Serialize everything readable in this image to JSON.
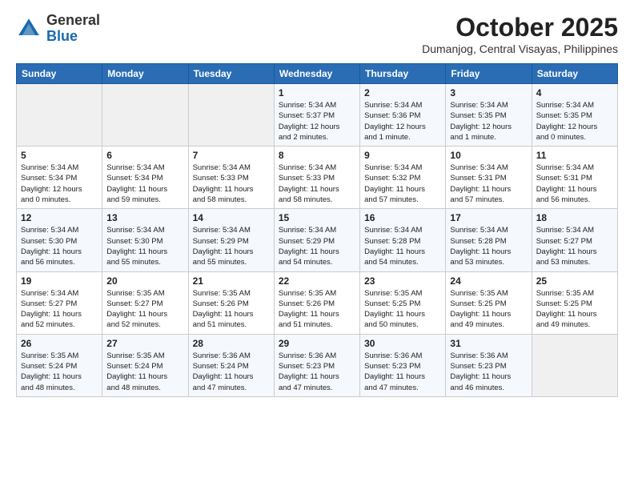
{
  "header": {
    "logo_general": "General",
    "logo_blue": "Blue",
    "month": "October 2025",
    "location": "Dumanjog, Central Visayas, Philippines"
  },
  "weekdays": [
    "Sunday",
    "Monday",
    "Tuesday",
    "Wednesday",
    "Thursday",
    "Friday",
    "Saturday"
  ],
  "weeks": [
    [
      {
        "day": "",
        "info": ""
      },
      {
        "day": "",
        "info": ""
      },
      {
        "day": "",
        "info": ""
      },
      {
        "day": "1",
        "info": "Sunrise: 5:34 AM\nSunset: 5:37 PM\nDaylight: 12 hours\nand 2 minutes."
      },
      {
        "day": "2",
        "info": "Sunrise: 5:34 AM\nSunset: 5:36 PM\nDaylight: 12 hours\nand 1 minute."
      },
      {
        "day": "3",
        "info": "Sunrise: 5:34 AM\nSunset: 5:35 PM\nDaylight: 12 hours\nand 1 minute."
      },
      {
        "day": "4",
        "info": "Sunrise: 5:34 AM\nSunset: 5:35 PM\nDaylight: 12 hours\nand 0 minutes."
      }
    ],
    [
      {
        "day": "5",
        "info": "Sunrise: 5:34 AM\nSunset: 5:34 PM\nDaylight: 12 hours\nand 0 minutes."
      },
      {
        "day": "6",
        "info": "Sunrise: 5:34 AM\nSunset: 5:34 PM\nDaylight: 11 hours\nand 59 minutes."
      },
      {
        "day": "7",
        "info": "Sunrise: 5:34 AM\nSunset: 5:33 PM\nDaylight: 11 hours\nand 58 minutes."
      },
      {
        "day": "8",
        "info": "Sunrise: 5:34 AM\nSunset: 5:33 PM\nDaylight: 11 hours\nand 58 minutes."
      },
      {
        "day": "9",
        "info": "Sunrise: 5:34 AM\nSunset: 5:32 PM\nDaylight: 11 hours\nand 57 minutes."
      },
      {
        "day": "10",
        "info": "Sunrise: 5:34 AM\nSunset: 5:31 PM\nDaylight: 11 hours\nand 57 minutes."
      },
      {
        "day": "11",
        "info": "Sunrise: 5:34 AM\nSunset: 5:31 PM\nDaylight: 11 hours\nand 56 minutes."
      }
    ],
    [
      {
        "day": "12",
        "info": "Sunrise: 5:34 AM\nSunset: 5:30 PM\nDaylight: 11 hours\nand 56 minutes."
      },
      {
        "day": "13",
        "info": "Sunrise: 5:34 AM\nSunset: 5:30 PM\nDaylight: 11 hours\nand 55 minutes."
      },
      {
        "day": "14",
        "info": "Sunrise: 5:34 AM\nSunset: 5:29 PM\nDaylight: 11 hours\nand 55 minutes."
      },
      {
        "day": "15",
        "info": "Sunrise: 5:34 AM\nSunset: 5:29 PM\nDaylight: 11 hours\nand 54 minutes."
      },
      {
        "day": "16",
        "info": "Sunrise: 5:34 AM\nSunset: 5:28 PM\nDaylight: 11 hours\nand 54 minutes."
      },
      {
        "day": "17",
        "info": "Sunrise: 5:34 AM\nSunset: 5:28 PM\nDaylight: 11 hours\nand 53 minutes."
      },
      {
        "day": "18",
        "info": "Sunrise: 5:34 AM\nSunset: 5:27 PM\nDaylight: 11 hours\nand 53 minutes."
      }
    ],
    [
      {
        "day": "19",
        "info": "Sunrise: 5:34 AM\nSunset: 5:27 PM\nDaylight: 11 hours\nand 52 minutes."
      },
      {
        "day": "20",
        "info": "Sunrise: 5:35 AM\nSunset: 5:27 PM\nDaylight: 11 hours\nand 52 minutes."
      },
      {
        "day": "21",
        "info": "Sunrise: 5:35 AM\nSunset: 5:26 PM\nDaylight: 11 hours\nand 51 minutes."
      },
      {
        "day": "22",
        "info": "Sunrise: 5:35 AM\nSunset: 5:26 PM\nDaylight: 11 hours\nand 51 minutes."
      },
      {
        "day": "23",
        "info": "Sunrise: 5:35 AM\nSunset: 5:25 PM\nDaylight: 11 hours\nand 50 minutes."
      },
      {
        "day": "24",
        "info": "Sunrise: 5:35 AM\nSunset: 5:25 PM\nDaylight: 11 hours\nand 49 minutes."
      },
      {
        "day": "25",
        "info": "Sunrise: 5:35 AM\nSunset: 5:25 PM\nDaylight: 11 hours\nand 49 minutes."
      }
    ],
    [
      {
        "day": "26",
        "info": "Sunrise: 5:35 AM\nSunset: 5:24 PM\nDaylight: 11 hours\nand 48 minutes."
      },
      {
        "day": "27",
        "info": "Sunrise: 5:35 AM\nSunset: 5:24 PM\nDaylight: 11 hours\nand 48 minutes."
      },
      {
        "day": "28",
        "info": "Sunrise: 5:36 AM\nSunset: 5:24 PM\nDaylight: 11 hours\nand 47 minutes."
      },
      {
        "day": "29",
        "info": "Sunrise: 5:36 AM\nSunset: 5:23 PM\nDaylight: 11 hours\nand 47 minutes."
      },
      {
        "day": "30",
        "info": "Sunrise: 5:36 AM\nSunset: 5:23 PM\nDaylight: 11 hours\nand 47 minutes."
      },
      {
        "day": "31",
        "info": "Sunrise: 5:36 AM\nSunset: 5:23 PM\nDaylight: 11 hours\nand 46 minutes."
      },
      {
        "day": "",
        "info": ""
      }
    ]
  ]
}
